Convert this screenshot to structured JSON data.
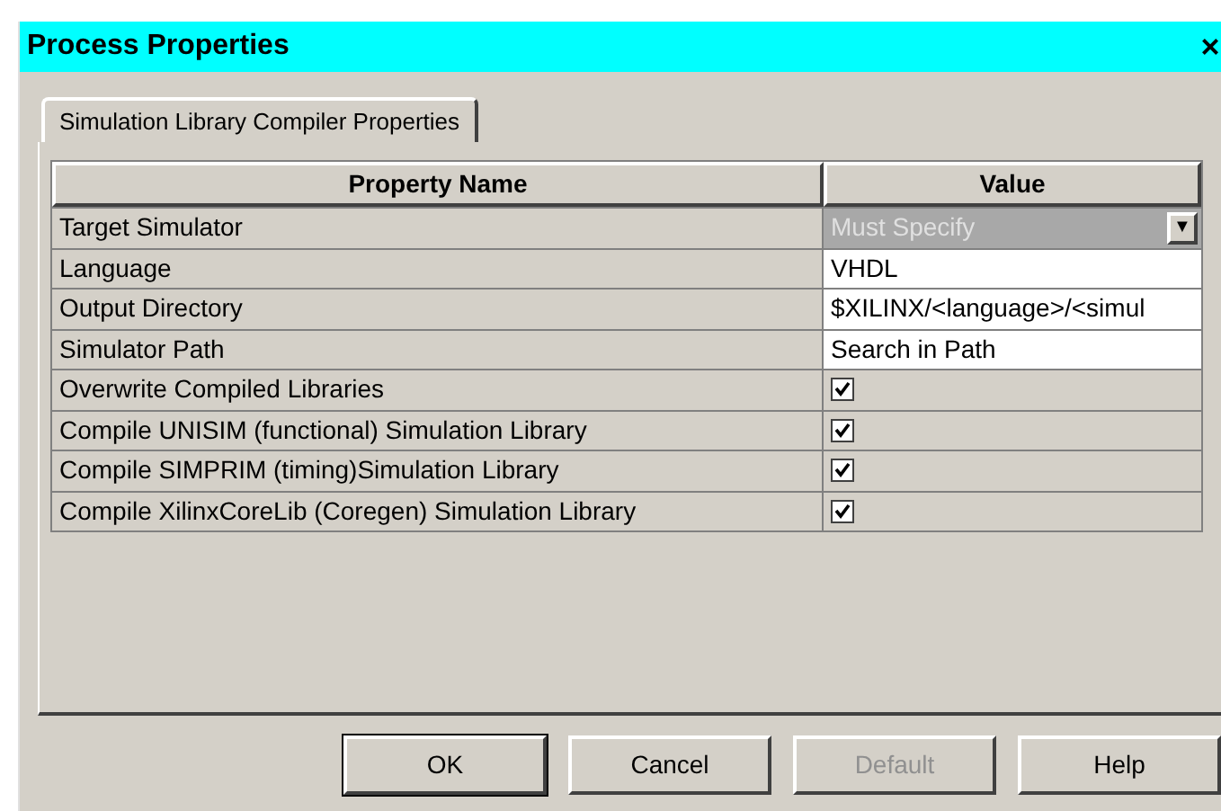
{
  "window": {
    "title": "Process Properties",
    "close": "×"
  },
  "tabs": [
    {
      "label": "Simulation Library Compiler Properties",
      "selected": true
    }
  ],
  "table": {
    "columns": [
      "Property Name",
      "Value"
    ],
    "rows": [
      {
        "name": "Target Simulator",
        "kind": "dropdown",
        "value": "Must Specify",
        "disabled": true,
        "arrow": "▼"
      },
      {
        "name": "Language",
        "kind": "text",
        "value": "VHDL"
      },
      {
        "name": "Output Directory",
        "kind": "text",
        "value": "$XILINX/<language>/<simul"
      },
      {
        "name": "Simulator Path",
        "kind": "text",
        "value": "Search in Path"
      },
      {
        "name": "Overwrite Compiled Libraries",
        "kind": "checkbox",
        "checked": true
      },
      {
        "name": "Compile UNISIM (functional) Simulation Library",
        "kind": "checkbox",
        "checked": true
      },
      {
        "name": "Compile SIMPRIM (timing)Simulation Library",
        "kind": "checkbox",
        "checked": true
      },
      {
        "name": "Compile XilinxCoreLib (Coregen) Simulation Library",
        "kind": "checkbox",
        "checked": true
      }
    ]
  },
  "buttons": [
    {
      "label": "OK",
      "disabled": false,
      "default": true
    },
    {
      "label": "Cancel",
      "disabled": false,
      "default": false
    },
    {
      "label": "Default",
      "disabled": true,
      "default": false
    },
    {
      "label": "Help",
      "disabled": false,
      "default": false
    }
  ]
}
